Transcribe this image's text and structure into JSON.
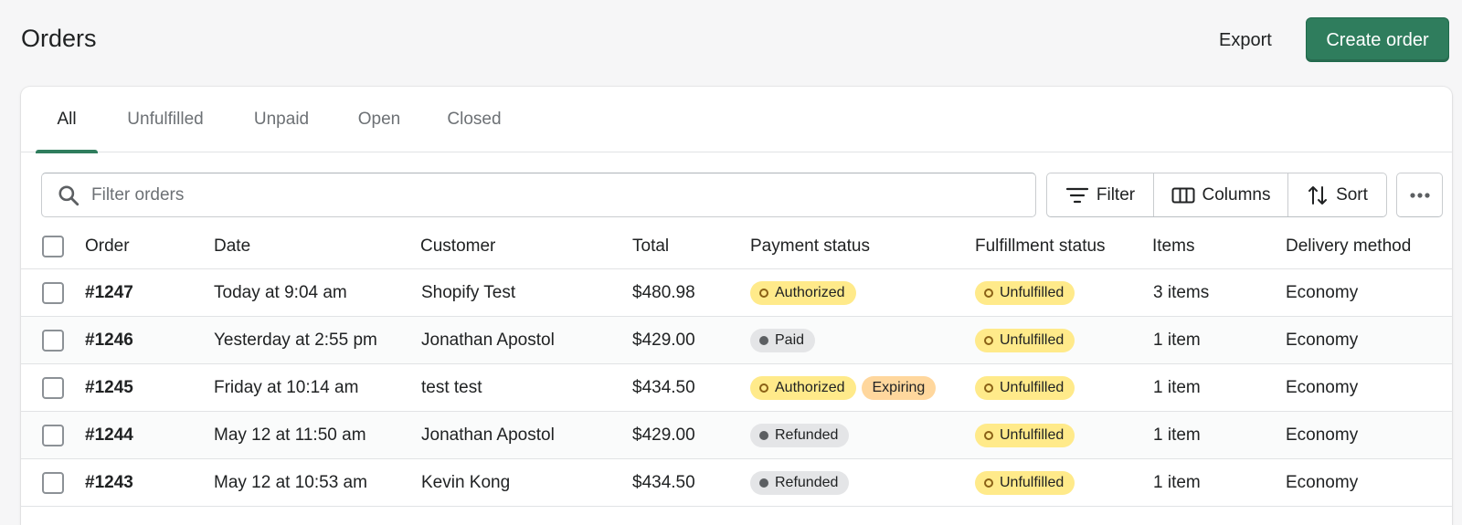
{
  "header": {
    "title": "Orders",
    "export_label": "Export",
    "create_label": "Create order"
  },
  "tabs": [
    {
      "label": "All",
      "active": true
    },
    {
      "label": "Unfulfilled",
      "active": false
    },
    {
      "label": "Unpaid",
      "active": false
    },
    {
      "label": "Open",
      "active": false
    },
    {
      "label": "Closed",
      "active": false
    }
  ],
  "toolbar": {
    "search_placeholder": "Filter orders",
    "search_value": "",
    "filter_label": "Filter",
    "columns_label": "Columns",
    "sort_label": "Sort"
  },
  "table": {
    "columns": {
      "order": "Order",
      "date": "Date",
      "customer": "Customer",
      "total": "Total",
      "payment": "Payment status",
      "fulfillment": "Fulfillment status",
      "items": "Items",
      "delivery": "Delivery method"
    },
    "rows": [
      {
        "order": "#1247",
        "date": "Today at 9:04 am",
        "customer": "Shopify Test",
        "total": "$480.98",
        "payment": "Authorized",
        "payment_extra": "",
        "fulfillment": "Unfulfilled",
        "items": "3 items",
        "delivery": "Economy"
      },
      {
        "order": "#1246",
        "date": "Yesterday at 2:55 pm",
        "customer": "Jonathan Apostol",
        "total": "$429.00",
        "payment": "Paid",
        "payment_extra": "",
        "fulfillment": "Unfulfilled",
        "items": "1 item",
        "delivery": "Economy"
      },
      {
        "order": "#1245",
        "date": "Friday at 10:14 am",
        "customer": "test test",
        "total": "$434.50",
        "payment": "Authorized",
        "payment_extra": "Expiring",
        "fulfillment": "Unfulfilled",
        "items": "1 item",
        "delivery": "Economy"
      },
      {
        "order": "#1244",
        "date": "May 12 at 11:50 am",
        "customer": "Jonathan Apostol",
        "total": "$429.00",
        "payment": "Refunded",
        "payment_extra": "",
        "fulfillment": "Unfulfilled",
        "items": "1 item",
        "delivery": "Economy"
      },
      {
        "order": "#1243",
        "date": "May 12 at 10:53 am",
        "customer": "Kevin Kong",
        "total": "$434.50",
        "payment": "Refunded",
        "payment_extra": "",
        "fulfillment": "Unfulfilled",
        "items": "1 item",
        "delivery": "Economy"
      }
    ]
  },
  "colors": {
    "accent": "#2f7d5d",
    "badge_warning": "#ffea8a",
    "badge_attention": "#ffd79d",
    "badge_neutral": "#e4e5e7"
  },
  "icons": {
    "search": "search-icon",
    "filter": "filter-icon",
    "columns": "columns-icon",
    "sort": "sort-icon",
    "more": "more-horizontal-icon"
  }
}
